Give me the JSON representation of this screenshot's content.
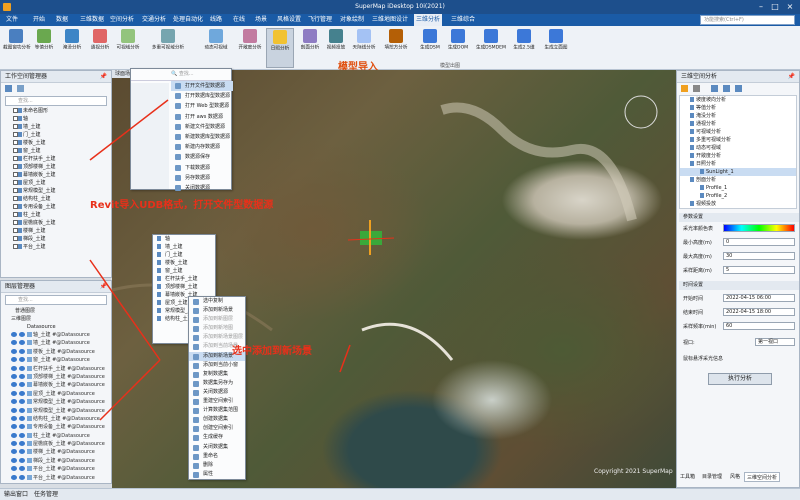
{
  "window": {
    "title": "SuperMap iDesktop 10i(2021)",
    "controls": [
      "–",
      "□",
      "×"
    ]
  },
  "menu": {
    "items": [
      "文件",
      "开始",
      "数据",
      "三维数据",
      "空间分析",
      "交通分析",
      "处理自动化",
      "线路",
      "在线",
      "场景",
      "风格设置",
      "飞行管理",
      "对象绘制",
      "三维地图设计",
      "三维分析",
      "三维综合"
    ],
    "active": "三维分析",
    "search_placeholder": "功能搜索(Ctrl+F)"
  },
  "ribbon": {
    "tools": [
      {
        "label": "截图窗功分析",
        "color": "#4a7fc0"
      },
      {
        "label": "等值分析",
        "color": "#6aa84f"
      },
      {
        "label": "淹没分析",
        "color": "#3d85c6"
      },
      {
        "label": "通视分析",
        "color": "#e06666"
      },
      {
        "label": "可视域分析",
        "color": "#93c47d"
      },
      {
        "label": "多重可视域分析",
        "color": "#76a5af"
      },
      {
        "label": "动态可视域",
        "color": "#6fa8dc"
      },
      {
        "label": "开敞度分析",
        "color": "#c27ba0"
      },
      {
        "label": "日照分析",
        "color": "#f1c232"
      },
      {
        "label": "剖面分析",
        "color": "#8e7cc3"
      },
      {
        "label": "视频投放",
        "color": "#45818e"
      },
      {
        "label": "天际线分析",
        "color": "#a4c2f4"
      },
      {
        "label": "填挖方分析",
        "color": "#b45f06"
      },
      {
        "label": "生成DSM",
        "color": "#3c78d8"
      },
      {
        "label": "生成DOM",
        "color": "#3c78d8"
      },
      {
        "label": "生成DSMDEM",
        "color": "#3c78d8"
      },
      {
        "label": "生成2.5维",
        "color": "#3c78d8"
      },
      {
        "label": "生成立面图",
        "color": "#3c78d8"
      }
    ],
    "selected_tool": "日照分析",
    "group_label": "模型出图",
    "annotation": "模型导入"
  },
  "workspace_panel": {
    "title": "工作空间管理器",
    "search_placeholder": "查找...",
    "items": [
      "未命名图形",
      "轴",
      "墙_土建",
      "门_土建",
      "楼板_土建",
      "窗_土建",
      "栏杆扶手_土建",
      "顶部楼梯_土建",
      "幕墙嵌板_土建",
      "屋顶_土建",
      "常规模型_土建",
      "结构柱_土建",
      "专用设备_土建",
      "柱_土建",
      "屋檐底板_土建",
      "楼梯_土建",
      "梯段_土建",
      "平台_土建"
    ]
  },
  "layer_panel": {
    "title": "图层管理器",
    "search_placeholder": "查找...",
    "root": "普通图层",
    "group": "三维图层",
    "datasource": "Datasource",
    "items": [
      "轴_土建 #@Datasource",
      "墙_土建 #@Datasource",
      "楼板_土建 #@Datasource",
      "窗_土建 #@Datasource",
      "栏杆扶手_土建 #@Datasource",
      "顶部楼梯_土建 #@Datasource",
      "幕墙嵌板_土建 #@Datasource",
      "屋顶_土建 #@Datasource",
      "常规模型_土建 #@Datasource",
      "常规模型_土建 #@Datasource",
      "结构柱_土建 #@Datasource",
      "专用设备_土建 #@Datasource",
      "柱_土建 #@Datasource",
      "屋檐底板_土建 #@Datasource",
      "楼梯_土建 #@Datasource",
      "梯段_土建 #@Datasource",
      "平台_土建 #@Datasource",
      "平台_土建 #@Datasource"
    ]
  },
  "popup_open": {
    "items": [
      "打开文件型数据源",
      "打开数据库型数据源",
      "打开 Web 型数据源",
      "打开 aws 数据源",
      "新建文件型数据源",
      "新建数据库型数据源",
      "新建内存数据源",
      "数据源保存",
      "下载数据源",
      "另存数据源",
      "关闭数据源"
    ],
    "highlight": "打开文件型数据源"
  },
  "popup_add": {
    "items": [
      "选中复制",
      "添加到新场景",
      "添加到新图层",
      "添加到新地图",
      "添加到新场景图层",
      "添加到当前场景",
      "添加到新场景",
      "添加到当前小窗",
      "复制数据集",
      "数据集另存为",
      "关闭数据源",
      "重建空间索引",
      "计算数据集范围",
      "创建数据集",
      "创建空间索引",
      "生成缓存",
      "关闭数据集",
      "重命名",
      "删除",
      "属性"
    ],
    "highlight": "添加到新场景"
  },
  "annotations": {
    "revit_note": "Revit导入UDB格式，打开文件型数据源",
    "add_note": "选中添加到新场景"
  },
  "map": {
    "tab": "球面场景",
    "scale_text": "比例尺",
    "copyright": "Copyright 2021 SuperMap"
  },
  "right_panel": {
    "title": "三维空间分析",
    "tree_items": [
      "坡度坡向分析",
      "等值分析",
      "淹没分析",
      "通视分析",
      "可视域分析",
      "多重可视域分析",
      "动态可视域",
      "开敞度分析",
      "日照分析",
      "SunLight_1",
      "剖面分析",
      "Profile_1",
      "Profile_2",
      "视频投放"
    ],
    "params_title": "参数设置",
    "colortable_label": "采光率颜色表",
    "min_height_label": "最小高度(m)",
    "min_height": "0",
    "max_height_label": "最大高度(m)",
    "max_height": "30",
    "sample_label": "采样距离(m)",
    "sample": "5",
    "time_title": "时间设置",
    "start_label": "开始时间",
    "start": "2022-04-15 06:00",
    "end_label": "结束时间",
    "end": "2022-04-15 18:00",
    "interval_label": "采样频率(min)",
    "interval": "60",
    "viewport_label": "视口:",
    "viewport_value": "第一视口",
    "show_result_label": "鼠标悬浮采光信息",
    "execute": "执行分析",
    "tabs": [
      "工具箱",
      "目录管理",
      "风格",
      "三维空间分析"
    ],
    "active_tab": "三维空间分析"
  },
  "status": {
    "tabs": [
      "输出窗口",
      "任务管理"
    ]
  },
  "colors": {
    "title_bar": "#1d4f8c",
    "menu_bar": "#1a5ba6",
    "annotation_red": "#e8301a",
    "annotation_orange": "#e05010"
  }
}
